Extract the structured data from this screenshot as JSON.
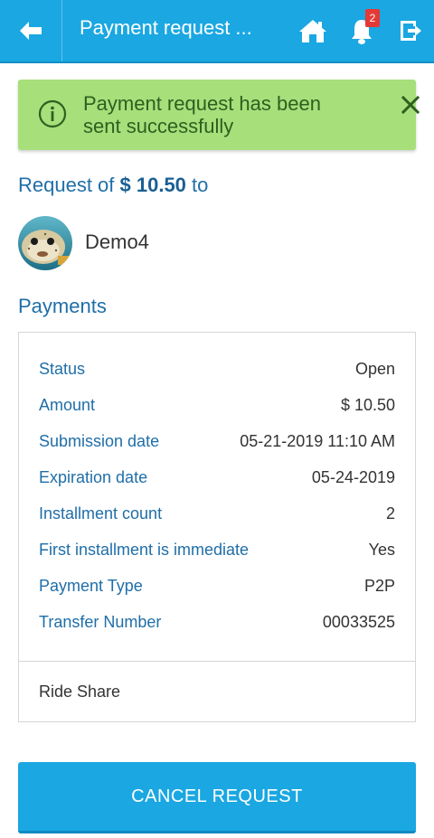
{
  "header": {
    "title": "Payment request ...",
    "notification_count": "2",
    "colors": {
      "bar": "#1aa7e2",
      "badge": "#e53935"
    }
  },
  "alert": {
    "message": "Payment request has been sent successfully",
    "color": "#a7df7b"
  },
  "request": {
    "prefix": "Request of ",
    "amount": "$ 10.50",
    "suffix": " to"
  },
  "recipient": {
    "name": "Demo4"
  },
  "payments": {
    "heading": "Payments",
    "rows": [
      {
        "label": "Status",
        "value": "Open"
      },
      {
        "label": "Amount",
        "value": "$ 10.50"
      },
      {
        "label": "Submission date",
        "value": "05-21-2019 11:10 AM"
      },
      {
        "label": "Expiration date",
        "value": "05-24-2019"
      },
      {
        "label": "Installment count",
        "value": "2"
      },
      {
        "label": "First installment is immediate",
        "value": "Yes"
      },
      {
        "label": "Payment Type",
        "value": "P2P"
      },
      {
        "label": "Transfer Number",
        "value": "00033525"
      }
    ],
    "note": "Ride Share"
  },
  "actions": {
    "cancel_label": "CANCEL REQUEST"
  }
}
